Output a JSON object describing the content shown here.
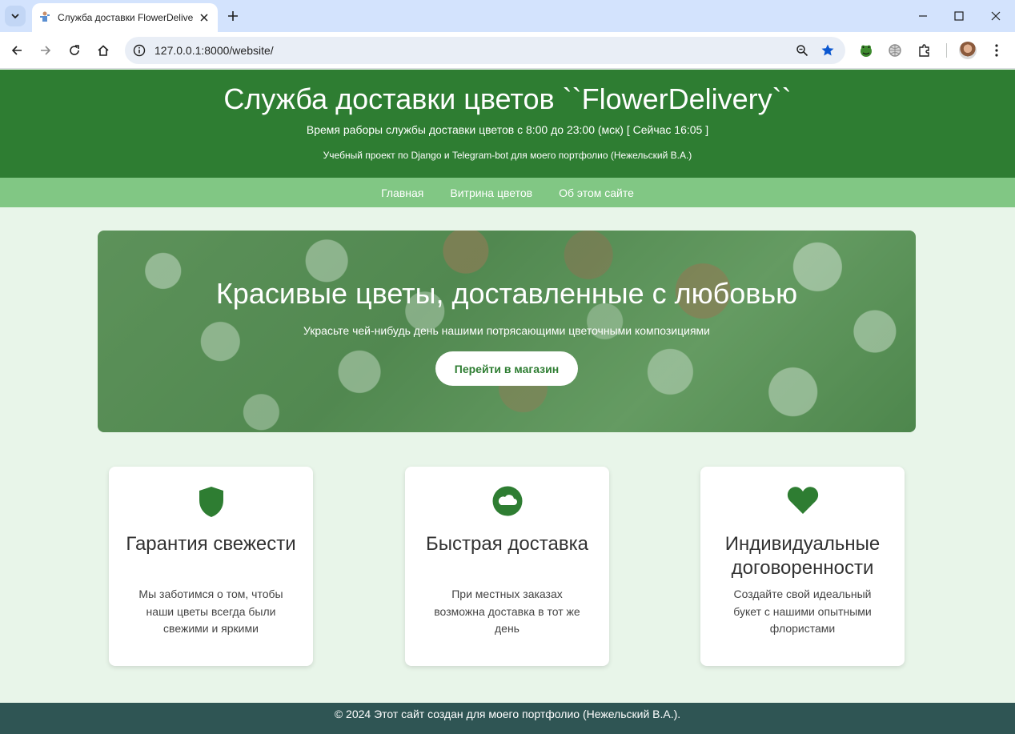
{
  "browser": {
    "tab_title": "Служба доставки FlowerDelivery",
    "url": "127.0.0.1:8000/website/"
  },
  "header": {
    "title": "Служба доставки цветов ``FlowerDelivery``",
    "hours": "Время раборы службы доставки цветов с 8:00 до 23:00 (мск) [ Сейчас 16:05 ]",
    "note": "Учебный проект по Django и Telegram-bot для моего портфолио (Нежельский В.А.)"
  },
  "nav": {
    "items": [
      {
        "label": "Главная"
      },
      {
        "label": "Витрина цветов"
      },
      {
        "label": "Об этом сайте"
      }
    ]
  },
  "hero": {
    "title": "Красивые цветы, доставленные с любовью",
    "subtitle": "Украсьте чей-нибудь день нашими потрясающими цветочными композициями",
    "button_label": "Перейти в магазин"
  },
  "features": [
    {
      "icon": "shield-icon",
      "title": "Гарантия свежести",
      "text": "Мы заботимся о том, чтобы наши цветы всегда были свежими и яркими"
    },
    {
      "icon": "cloud-icon",
      "title": "Быстрая доставка",
      "text": "При местных заказах возможна доставка в тот же день"
    },
    {
      "icon": "heart-icon",
      "title": "Индивидуальные договоренности",
      "text": "Создайте свой идеальный букет с нашими опытными флористами"
    }
  ],
  "footer": {
    "text": "© 2024 Этот сайт создан для моего портфолио (Нежельский В.А.)."
  },
  "colors": {
    "header_bg": "#2e7d32",
    "nav_bg": "#81c784",
    "page_bg": "#e8f5e9",
    "footer_bg": "#2f5554",
    "accent": "#2e7d32"
  }
}
